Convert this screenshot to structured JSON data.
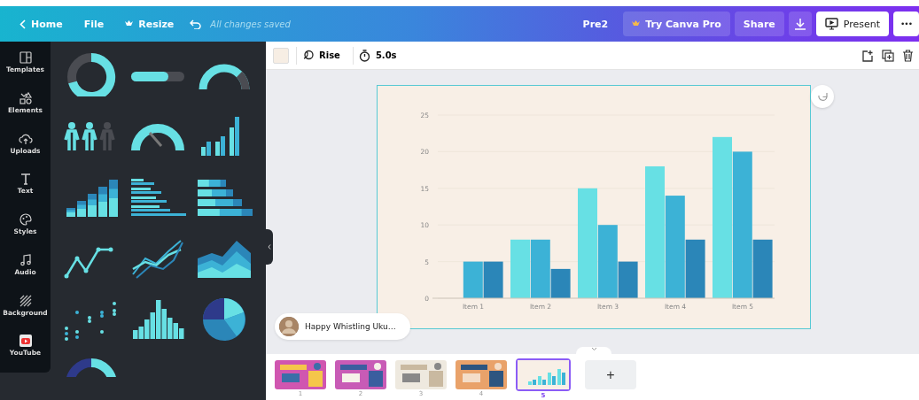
{
  "topbar": {
    "home": "Home",
    "file": "File",
    "resize": "Resize",
    "status": "All changes saved",
    "title": "Pre2",
    "pro": "Try Canva Pro",
    "share": "Share",
    "present": "Present",
    "more": "•••"
  },
  "sidebar": {
    "items": [
      {
        "label": "Templates",
        "kind": "templates"
      },
      {
        "label": "Elements",
        "kind": "elements"
      },
      {
        "label": "Uploads",
        "kind": "uploads"
      },
      {
        "label": "Text",
        "kind": "text"
      },
      {
        "label": "Styles",
        "kind": "styles"
      },
      {
        "label": "Audio",
        "kind": "audio"
      },
      {
        "label": "Background",
        "kind": "background"
      },
      {
        "label": "YouTube",
        "kind": "youtube"
      }
    ],
    "graphics": [
      {
        "kind": "donut"
      },
      {
        "kind": "progress"
      },
      {
        "kind": "half-donut"
      },
      {
        "kind": "people"
      },
      {
        "kind": "gauge"
      },
      {
        "kind": "bars"
      },
      {
        "kind": "stacked-bars"
      },
      {
        "kind": "hbars"
      },
      {
        "kind": "stacked-rows"
      },
      {
        "kind": "line"
      },
      {
        "kind": "multi-line"
      },
      {
        "kind": "area"
      },
      {
        "kind": "dots"
      },
      {
        "kind": "histogram"
      },
      {
        "kind": "pie"
      },
      {
        "kind": "donut-partial"
      }
    ]
  },
  "toolbar": {
    "animation": "Rise",
    "duration": "5.0s"
  },
  "canvas": {
    "chart_data": {
      "type": "bar",
      "categories": [
        "Item 1",
        "Item 2",
        "Item 3",
        "Item 4",
        "Item 5"
      ],
      "series": [
        {
          "color": "#67e0e4",
          "values": [
            0,
            8,
            15,
            18,
            22
          ]
        },
        {
          "color": "#3cb2d6",
          "values": [
            5,
            8,
            10,
            14,
            20
          ]
        },
        {
          "color": "#2b86b8",
          "values": [
            5,
            4,
            5,
            8,
            8
          ]
        }
      ],
      "grid": true,
      "ylim": [
        0,
        25
      ],
      "yticks": [
        0,
        5,
        10,
        15,
        20,
        25
      ]
    },
    "collaborator": {
      "name": "Happy Whistling Uku…"
    }
  },
  "pages": {
    "items": [
      {
        "number": "1",
        "selected": false
      },
      {
        "number": "2",
        "selected": false
      },
      {
        "number": "3",
        "selected": false
      },
      {
        "number": "4",
        "selected": false
      },
      {
        "number": "5",
        "selected": true
      }
    ],
    "add": "+"
  }
}
